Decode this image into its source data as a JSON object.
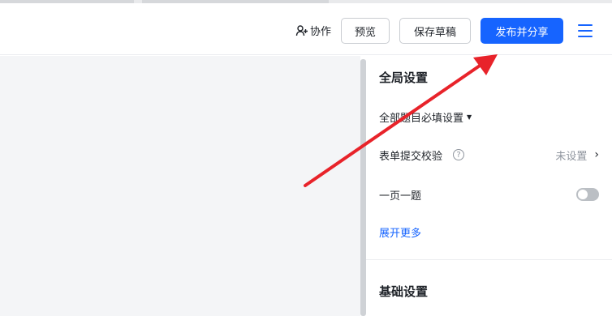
{
  "header": {
    "collab_label": "协作",
    "preview_label": "预览",
    "save_draft_label": "保存草稿",
    "publish_share_label": "发布并分享"
  },
  "settings_panel": {
    "global_title": "全局设置",
    "all_required_label": "全部题目必填设置",
    "submit_validation_label": "表单提交校验",
    "submit_validation_value": "未设置",
    "one_per_page_label": "一页一题",
    "one_per_page_enabled": false,
    "expand_more_label": "展开更多",
    "basic_title": "基础设置"
  },
  "colors": {
    "accent": "#1664ff",
    "annotation_arrow": "#e8232a"
  },
  "icons": [
    "add-user-icon",
    "menu-icon",
    "help-circle-icon",
    "chevron-right-icon",
    "caret-down-icon"
  ]
}
